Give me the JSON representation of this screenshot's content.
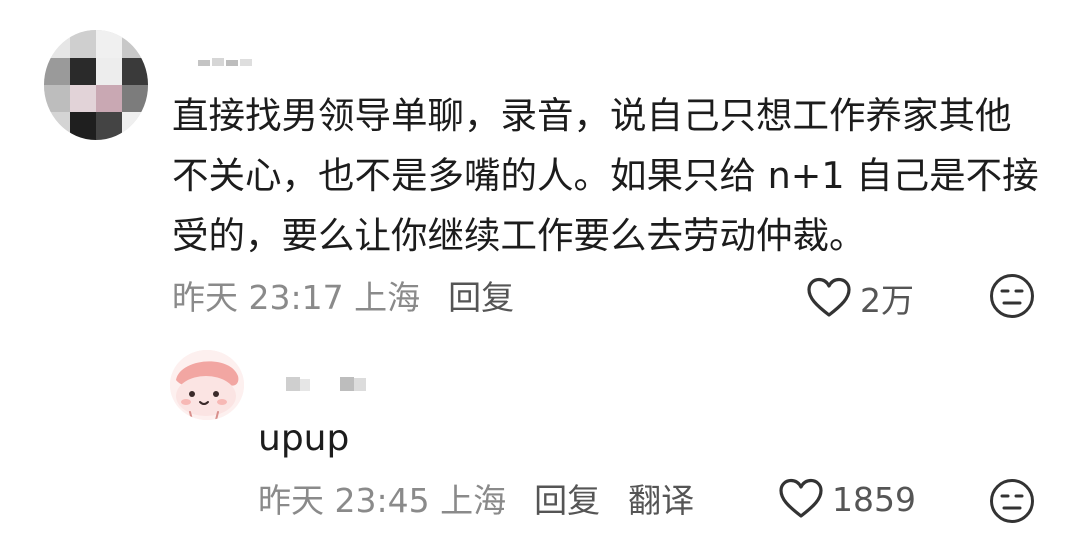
{
  "comment": {
    "text": "直接找男领导单聊，录音，说自己只想工作养家其他\n不关心，也不是多嘴的人。如果只给 n+1 自己是不接\n受的，要么让你继续工作要么去劳动仲裁。",
    "time": "昨天 23:17 上海",
    "reply_label": "回复",
    "like_count": "2万",
    "icons": {
      "like": "heart-outline-icon",
      "reaction": "neutral-face-icon"
    }
  },
  "reply": {
    "text": "upup",
    "time": "昨天 23:45 上海",
    "reply_label": "回复",
    "translate_label": "翻译",
    "like_count": "1859",
    "icons": {
      "like": "heart-outline-icon",
      "reaction": "neutral-face-icon"
    }
  },
  "colors": {
    "text": "#1c1c1c",
    "meta": "#8a8a8a",
    "action": "#555555"
  }
}
